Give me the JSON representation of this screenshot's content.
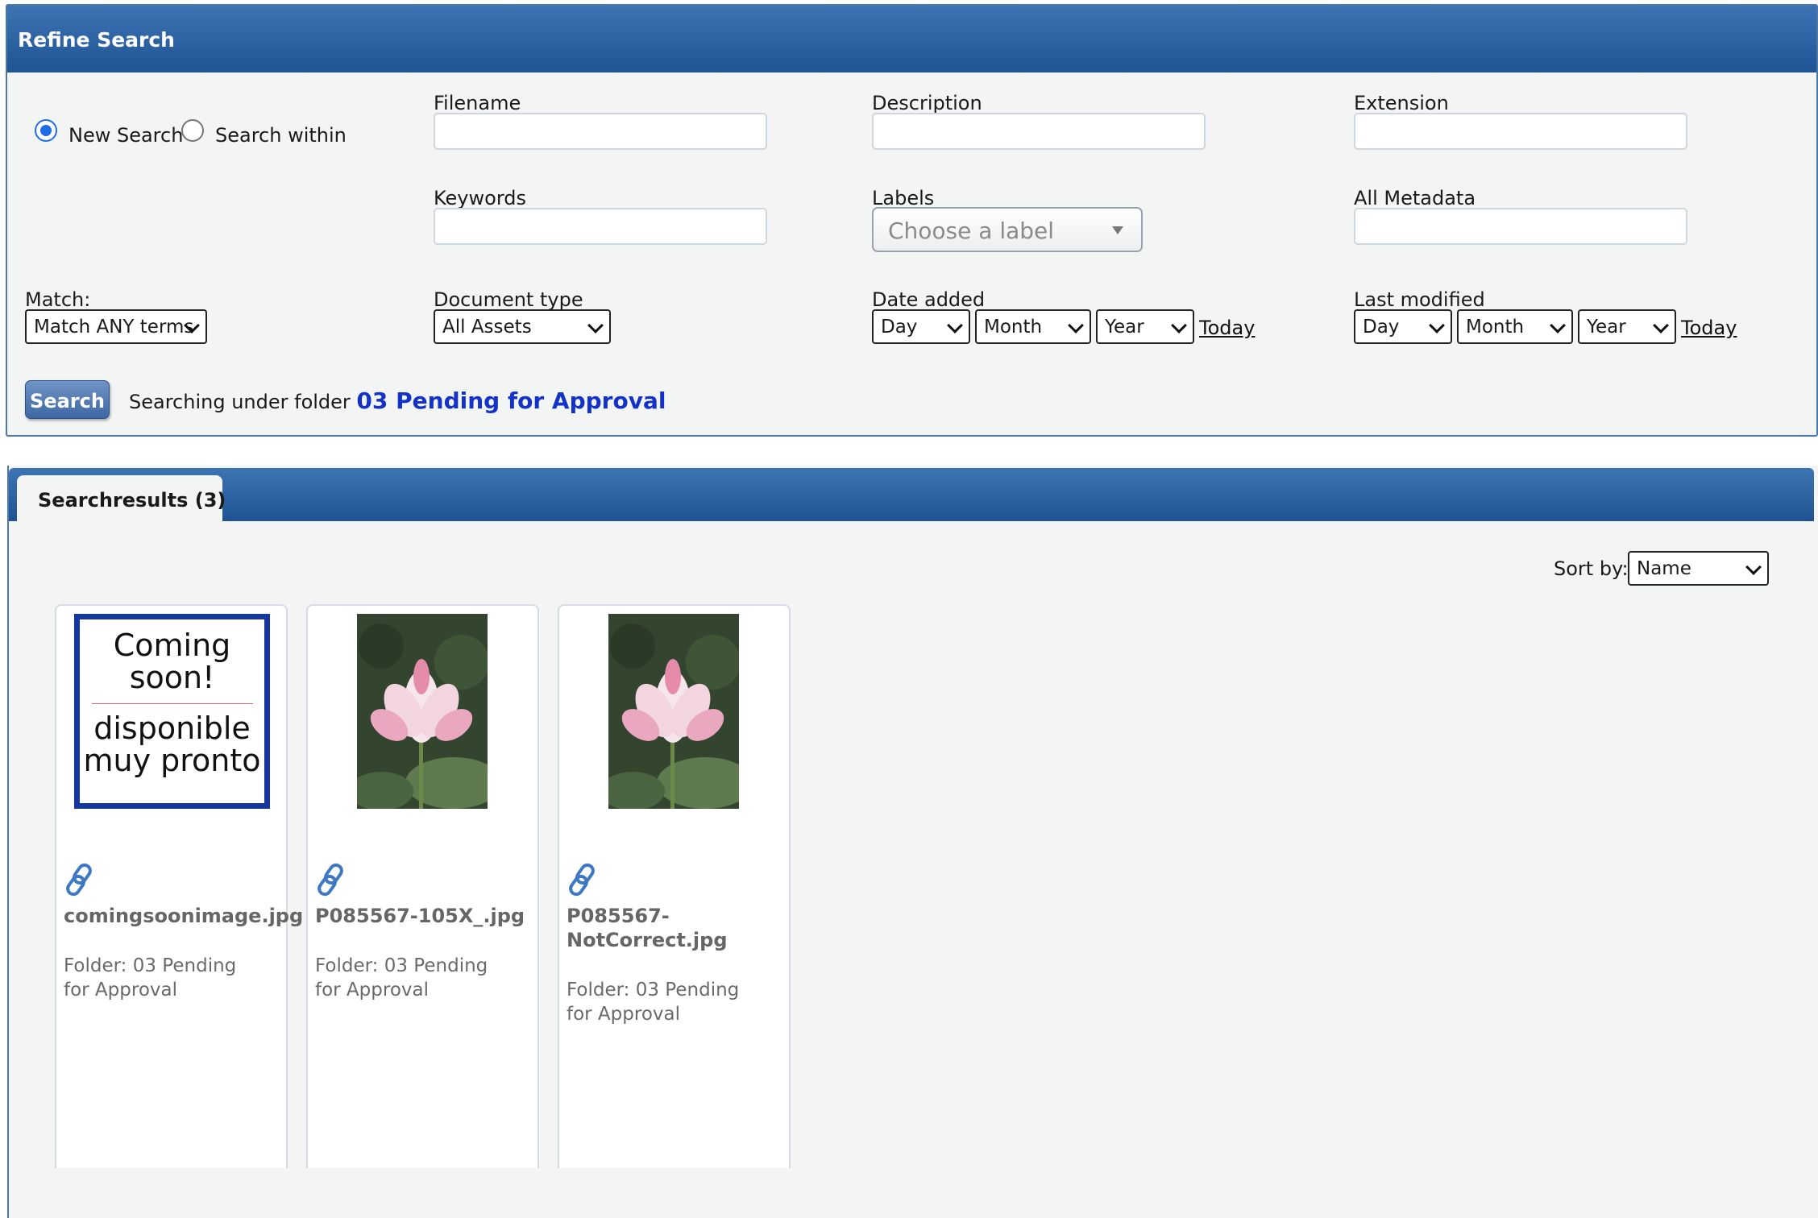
{
  "refine_search": {
    "title": "Refine Search",
    "mode_options": [
      "New Search",
      "Search within"
    ],
    "selected_mode": "New Search",
    "filename_label": "Filename",
    "filename_value": "",
    "description_label": "Description",
    "description_value": "",
    "extension_label": "Extension",
    "extension_value": "",
    "keywords_label": "Keywords",
    "keywords_value": "",
    "labels_label": "Labels",
    "labels_placeholder": "Choose a label",
    "all_metadata_label": "All Metadata",
    "all_metadata_value": "",
    "match_label": "Match:",
    "match_value": "Match ANY terms",
    "document_type_label": "Document type",
    "document_type_value": "All Assets",
    "date_added": {
      "label": "Date added",
      "day": "Day",
      "month": "Month",
      "year": "Year",
      "today_link": "Today"
    },
    "last_modified": {
      "label": "Last modified",
      "day": "Day",
      "month": "Month",
      "year": "Year",
      "today_link": "Today"
    },
    "search_button": "Search",
    "searching_under_text": "Searching under folder",
    "current_folder": "03 Pending for Approval"
  },
  "results": {
    "tab_label": "Searchresults (3)",
    "sort_label": "Sort by:",
    "sort_value": "Name",
    "items": [
      {
        "thumbnail_type": "coming-soon",
        "thumb_text_en": "Coming soon!",
        "thumb_text_es": "disponible muy pronto",
        "filename": "comingsoonimage.jpg",
        "folder": "Folder: 03 Pending for Approval"
      },
      {
        "thumbnail_type": "lotus-photo",
        "filename": "P085567-105X_.jpg",
        "folder": "Folder: 03 Pending for Approval"
      },
      {
        "thumbnail_type": "lotus-photo",
        "filename": "P085567-NotCorrect.jpg",
        "folder": "Folder: 03 Pending for Approval"
      }
    ],
    "item_icon": "link-icon"
  },
  "colors": {
    "header_blue": "#2a61a3",
    "link_blue": "#1232c8",
    "panel_background": "#f3f5f5",
    "icon_blue": "#3f78c2"
  }
}
